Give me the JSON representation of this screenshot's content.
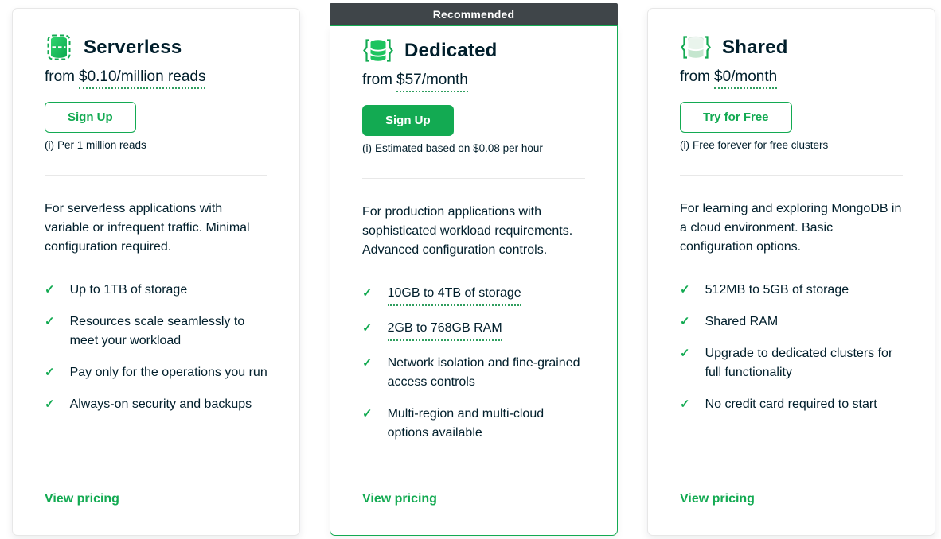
{
  "colors": {
    "accent_green": "#13AA52",
    "text_dark": "#001E2B",
    "banner_bg": "#3F4549",
    "card_border": "#E7E7E7"
  },
  "icons": {
    "check": "✓",
    "serverless": "serverless-database-icon",
    "dedicated": "dedicated-database-icon",
    "shared": "shared-database-icon"
  },
  "cards": [
    {
      "id": "serverless",
      "title": "Serverless",
      "price_prefix": "from",
      "price_amount": "$0.10/million reads",
      "cta_label": "Sign Up",
      "info_mark": "(i)",
      "caption": "Per 1 million reads",
      "description": "For serverless applications with variable or infrequent traffic. Minimal configuration required.",
      "features": [
        {
          "text": "Up to 1TB of storage",
          "underlined": false
        },
        {
          "text": "Resources scale seamlessly to meet your workload",
          "underlined": false
        },
        {
          "text": "Pay only for the operations you run",
          "underlined": false
        },
        {
          "text": "Always-on security and backups",
          "underlined": false
        }
      ],
      "link_label": "View pricing"
    },
    {
      "id": "dedicated",
      "banner": "Recommended",
      "title": "Dedicated",
      "price_prefix": "from",
      "price_amount": "$57/month",
      "cta_label": "Sign Up",
      "info_mark": "(i)",
      "caption": "Estimated based on $0.08 per hour",
      "description": "For production applications with sophisticated workload requirements. Advanced configuration controls.",
      "features": [
        {
          "text": "10GB to 4TB of storage",
          "underlined": true
        },
        {
          "text": "2GB to 768GB RAM",
          "underlined": true
        },
        {
          "text": "Network isolation and fine-grained access controls",
          "underlined": false
        },
        {
          "text": "Multi-region and multi-cloud options available",
          "underlined": false
        }
      ],
      "link_label": "View pricing"
    },
    {
      "id": "shared",
      "title": "Shared",
      "price_prefix": "from",
      "price_amount": "$0/month",
      "cta_label": "Try for Free",
      "info_mark": "(i)",
      "caption": "Free forever for free clusters",
      "description": "For learning and exploring MongoDB in a cloud environment. Basic configuration options.",
      "features": [
        {
          "text": "512MB to 5GB of storage",
          "underlined": false
        },
        {
          "text": "Shared RAM",
          "underlined": false
        },
        {
          "text": "Upgrade to dedicated clusters for full functionality",
          "underlined": false
        },
        {
          "text": "No credit card required to start",
          "underlined": false
        }
      ],
      "link_label": "View pricing"
    }
  ]
}
